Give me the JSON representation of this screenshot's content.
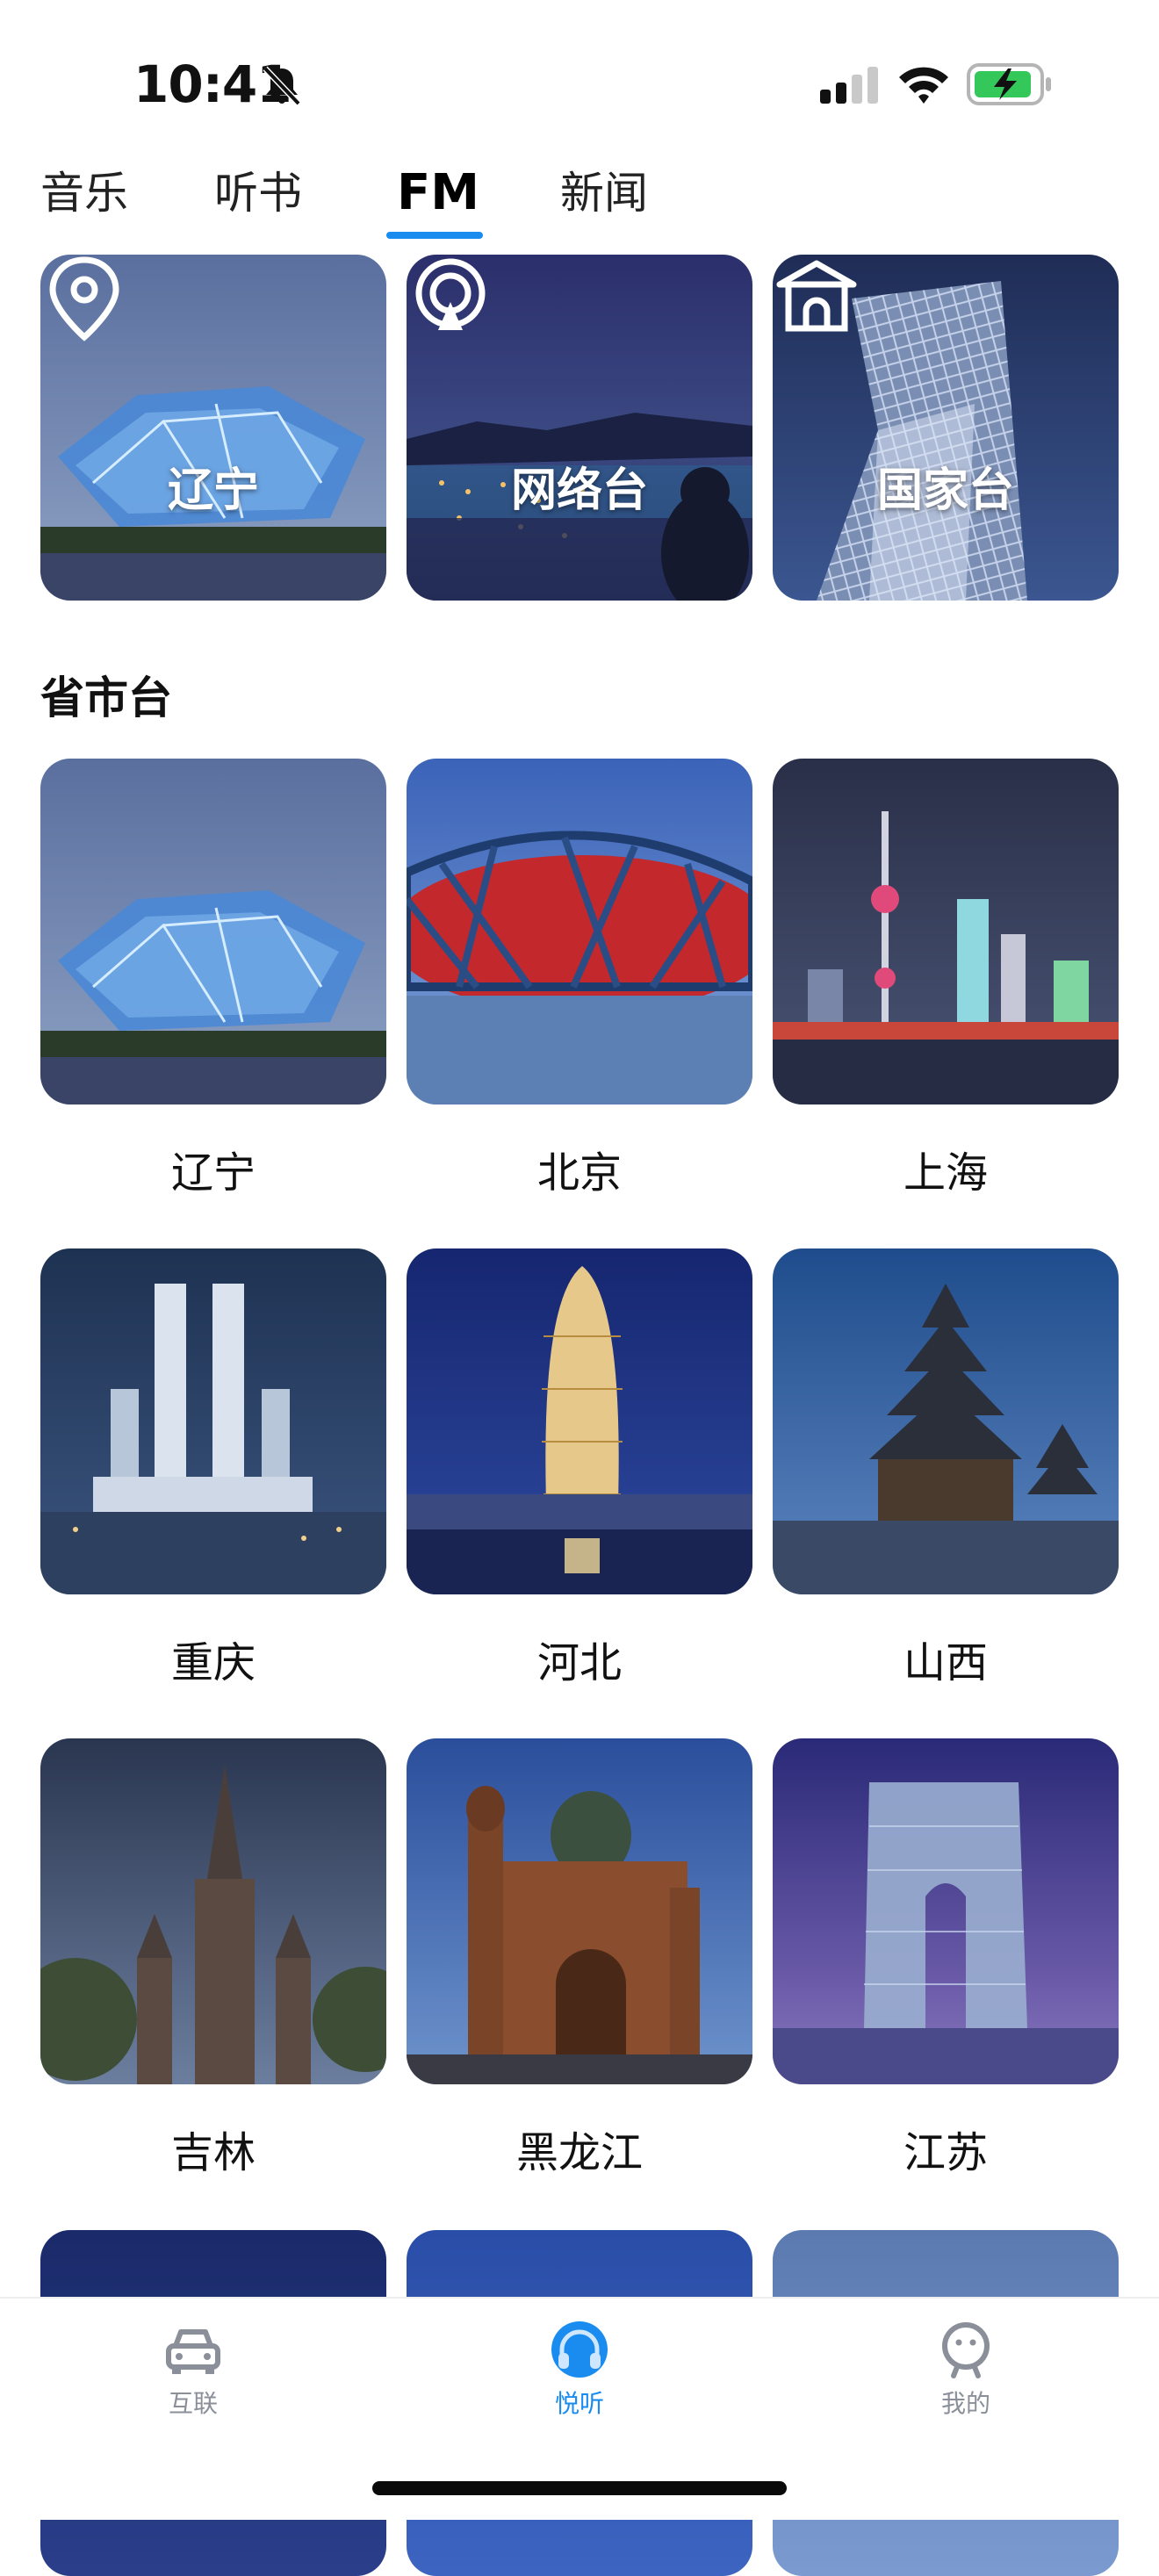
{
  "status_bar": {
    "time": "10:41",
    "icons": [
      "bell-slash-icon",
      "signal-icon",
      "wifi-icon",
      "battery-charging-icon"
    ]
  },
  "tabs": [
    {
      "label": "音乐",
      "active": false
    },
    {
      "label": "听书",
      "active": false
    },
    {
      "label": "FM",
      "active": true
    },
    {
      "label": "新闻",
      "active": false
    }
  ],
  "categories": [
    {
      "label": "辽宁",
      "icon": "location-pin-icon"
    },
    {
      "label": "网络台",
      "icon": "broadcast-icon"
    },
    {
      "label": "国家台",
      "icon": "gate-icon"
    }
  ],
  "section_title": "省市台",
  "cities": [
    "辽宁",
    "北京",
    "上海",
    "重庆",
    "河北",
    "山西",
    "吉林",
    "黑龙江",
    "江苏"
  ],
  "bottom_nav": [
    {
      "label": "互联",
      "icon": "car-icon",
      "active": false
    },
    {
      "label": "悦听",
      "icon": "headphones-icon",
      "active": true
    },
    {
      "label": "我的",
      "icon": "user-face-icon",
      "active": false
    }
  ],
  "colors": {
    "accent": "#1a8cf0",
    "nav_inactive": "#8a8f99"
  }
}
